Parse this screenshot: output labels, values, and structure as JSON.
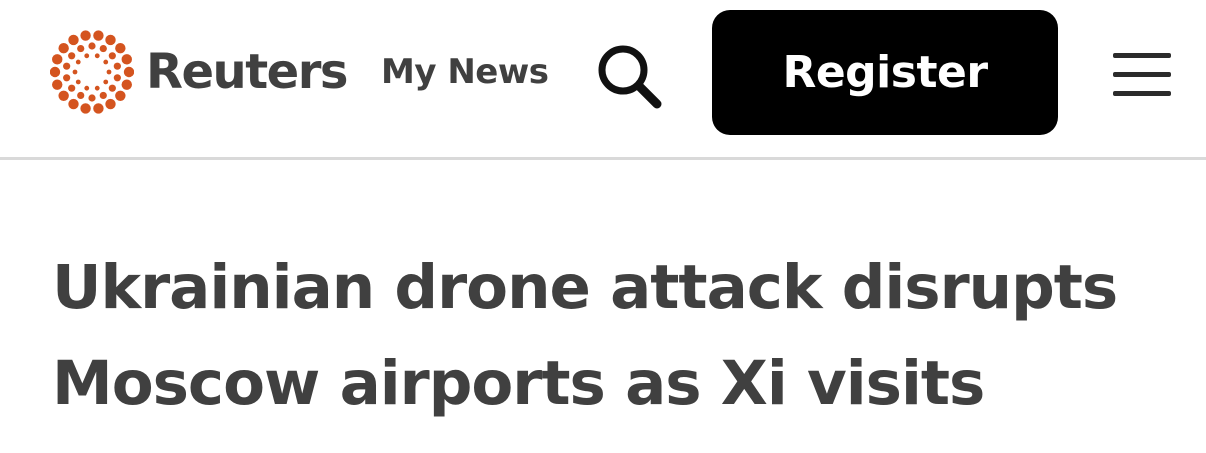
{
  "header": {
    "brand_name": "Reuters",
    "my_news_label": "My News",
    "register_label": "Register",
    "icons": {
      "logo": "reuters-dot-ring-logo",
      "search": "search-icon",
      "menu": "hamburger-menu-icon"
    },
    "colors": {
      "logo_dots": "#d4541f",
      "register_bg": "#000000",
      "text": "#404040"
    }
  },
  "article": {
    "headline": "Ukrainian drone attack disrupts Moscow airports as Xi visits"
  }
}
